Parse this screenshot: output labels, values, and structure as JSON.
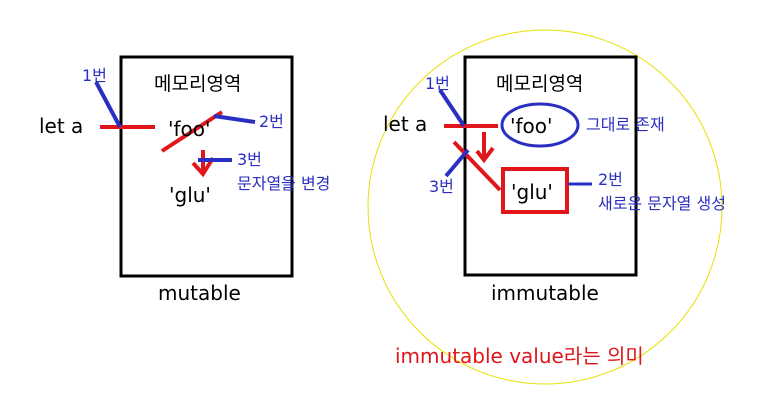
{
  "left": {
    "box_title": "메모리영역",
    "var_label": "let a",
    "value_old": "'foo'",
    "value_new": "'glu'",
    "caption": "mutable",
    "step1": "1번",
    "step2": "2번",
    "step3": "3번",
    "step3_note": "문자열을 변경"
  },
  "right": {
    "box_title": "메모리영역",
    "var_label": "let a",
    "value_old": "'foo'",
    "value_new": "'glu'",
    "caption": "immutable",
    "step1": "1번",
    "step2": "2번",
    "step3": "3번",
    "old_note": "그대로 존재",
    "new_note": "새로운 문자열 생성"
  },
  "footer": "immutable value라는 의미",
  "colors": {
    "red": "#e0161b",
    "blue": "#2a2fc2",
    "yellow": "#e8e000"
  }
}
